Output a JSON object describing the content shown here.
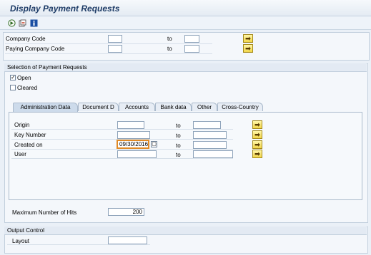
{
  "title": "Display Payment Requests",
  "toolbar": {
    "icons": [
      "execute-icon",
      "variant-icon",
      "info-icon"
    ]
  },
  "top": {
    "rows": [
      {
        "label": "Company Code",
        "to": "to"
      },
      {
        "label": "Paying Company Code",
        "to": "to"
      }
    ]
  },
  "selection": {
    "title": "Selection of Payment Requests",
    "open_label": "Open",
    "open_checked": true,
    "cleared_label": "Cleared",
    "cleared_checked": false
  },
  "tabs": [
    "Administration Data",
    "Document D",
    "Accounts",
    "Bank data",
    "Other",
    "Cross-Country"
  ],
  "active_tab": "Administration Data",
  "admin": {
    "rows": [
      {
        "label": "Origin",
        "from": "",
        "to_label": "to",
        "to": ""
      },
      {
        "label": "Key Number",
        "from": "",
        "to_label": "to",
        "to": ""
      },
      {
        "label": "Created on",
        "from": "09/30/2016",
        "to_label": "to",
        "to": ""
      },
      {
        "label": "User",
        "from": "",
        "to_label": "to",
        "to": ""
      }
    ]
  },
  "max_hits": {
    "label": "Maximum Number of Hits",
    "value": "200"
  },
  "output": {
    "title": "Output Control",
    "layout_label": "Layout",
    "layout_value": ""
  },
  "colors": {
    "accent": "#1d3b66",
    "button": "#f2d64a"
  }
}
